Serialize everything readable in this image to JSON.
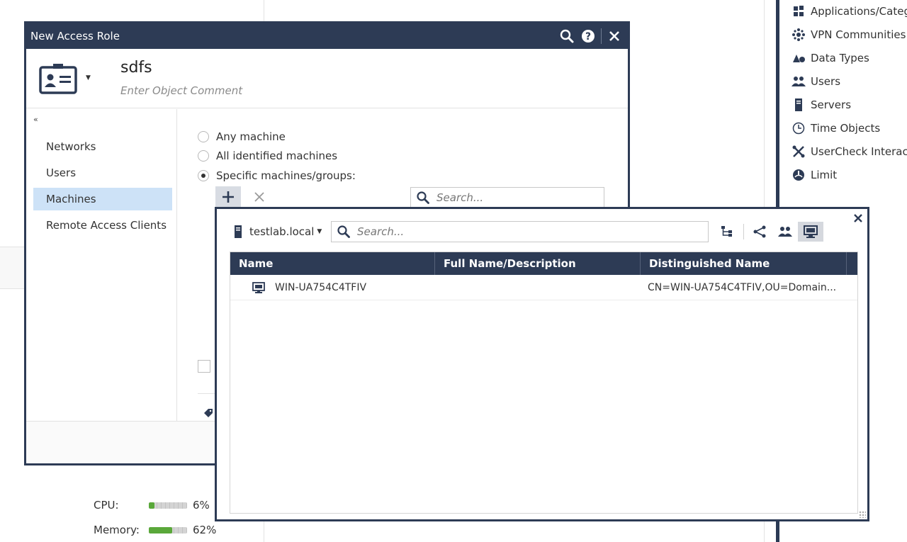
{
  "sidebar_right": {
    "items": [
      {
        "label": "Applications/Categories",
        "icon": "applications-icon"
      },
      {
        "label": "VPN Communities",
        "icon": "vpn-communities-icon"
      },
      {
        "label": "Data Types",
        "icon": "data-types-icon"
      },
      {
        "label": "Users",
        "icon": "users-icon"
      },
      {
        "label": "Servers",
        "icon": "servers-icon"
      },
      {
        "label": "Time Objects",
        "icon": "clock-icon"
      },
      {
        "label": "UserCheck Interactions",
        "icon": "usercheck-icon"
      },
      {
        "label": "Limit",
        "icon": "limit-icon"
      }
    ]
  },
  "status": {
    "cpu_label": "CPU:",
    "cpu_value": "6%",
    "cpu_fraction": 0.06,
    "memory_label": "Memory:",
    "memory_value": "62%",
    "memory_fraction": 0.62
  },
  "access_role_dialog": {
    "title": "New Access Role",
    "object_name": "sdfs",
    "object_comment_placeholder": "Enter Object Comment",
    "nav": {
      "collapse_glyph": "«",
      "items": [
        "Networks",
        "Users",
        "Machines",
        "Remote Access Clients"
      ],
      "selected": "Machines"
    },
    "machines": {
      "options": [
        "Any machine",
        "All identified machines",
        "Specific machines/groups:"
      ],
      "selected": "Specific machines/groups:",
      "search_placeholder": "Search..."
    }
  },
  "machine_picker": {
    "domain": "testlab.local",
    "search_placeholder": "Search...",
    "columns": [
      "Name",
      "Full Name/Description",
      "Distinguished Name"
    ],
    "rows": [
      {
        "name": "WIN-UA754C4TFIV",
        "description": "",
        "dn": "CN=WIN-UA754C4TFIV,OU=Domain..."
      }
    ]
  },
  "colors": {
    "title_bar": "#2d3b55",
    "nav_selected": "#cde2f7",
    "meter_fill": "#5aa83a"
  }
}
